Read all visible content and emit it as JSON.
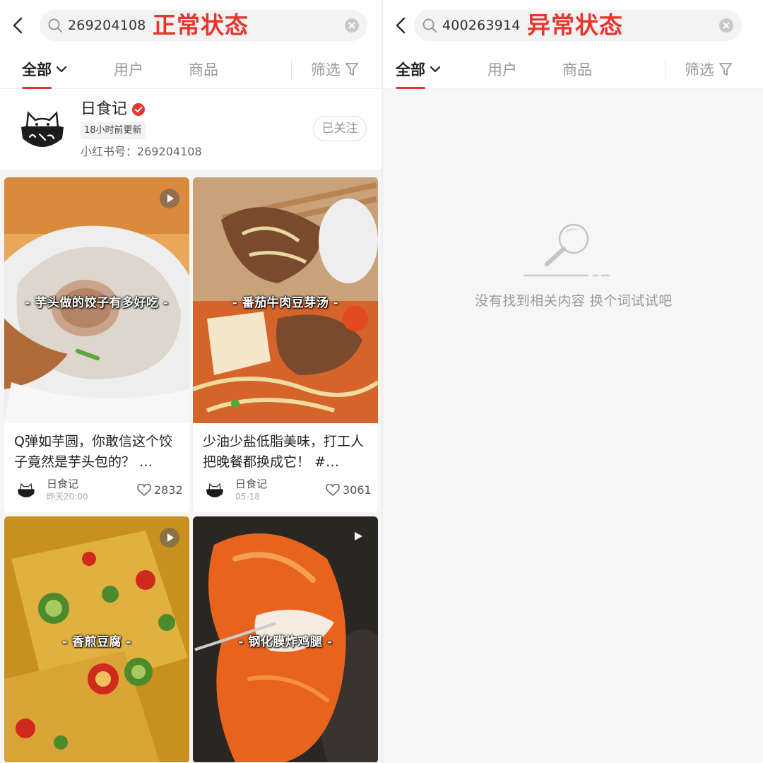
{
  "left_panel": {
    "search_value": "269204108",
    "state_label": "正常状态",
    "tabs": [
      {
        "label": "全部"
      },
      {
        "label": "用户"
      },
      {
        "label": "商品"
      }
    ],
    "filter_label": "筛选",
    "user_card": {
      "name": "日食记",
      "update_badge": "18小时前更新",
      "user_id": "小红书号：269204108",
      "follow_label": "已关注"
    },
    "notes": [
      {
        "caption": "- 芋头做的饺子有多好吃 -",
        "title": "Q弹如芋圆，你敢信这个饺子竟然是芋头包的？ …",
        "author": "日食记",
        "time": "昨天20:00",
        "likes": "2832"
      },
      {
        "caption": "- 番茄牛肉豆芽汤 -",
        "title": "少油少盐低脂美味，打工人把晚餐都换成它！ #…",
        "author": "日食记",
        "time": "05-18",
        "likes": "3061"
      },
      {
        "caption": "- 香煎豆腐 -"
      },
      {
        "caption": "- 钢化膜炸鸡腿 -"
      }
    ]
  },
  "right_panel": {
    "search_value": "400263914",
    "state_label": "异常状态",
    "tabs": [
      {
        "label": "全部"
      },
      {
        "label": "用户"
      },
      {
        "label": "商品"
      }
    ],
    "filter_label": "筛选",
    "empty_text": "没有找到相关内容 换个词试试吧"
  },
  "colors": {
    "accent": "#e8362d",
    "verified": "#e8362d",
    "empty_bg": "#f6f6f6"
  },
  "icons": [
    "back-icon",
    "search-icon",
    "clear-icon",
    "chevron-down-icon",
    "filter-icon",
    "verified-icon",
    "play-icon",
    "heart-icon",
    "magnifier-icon"
  ]
}
